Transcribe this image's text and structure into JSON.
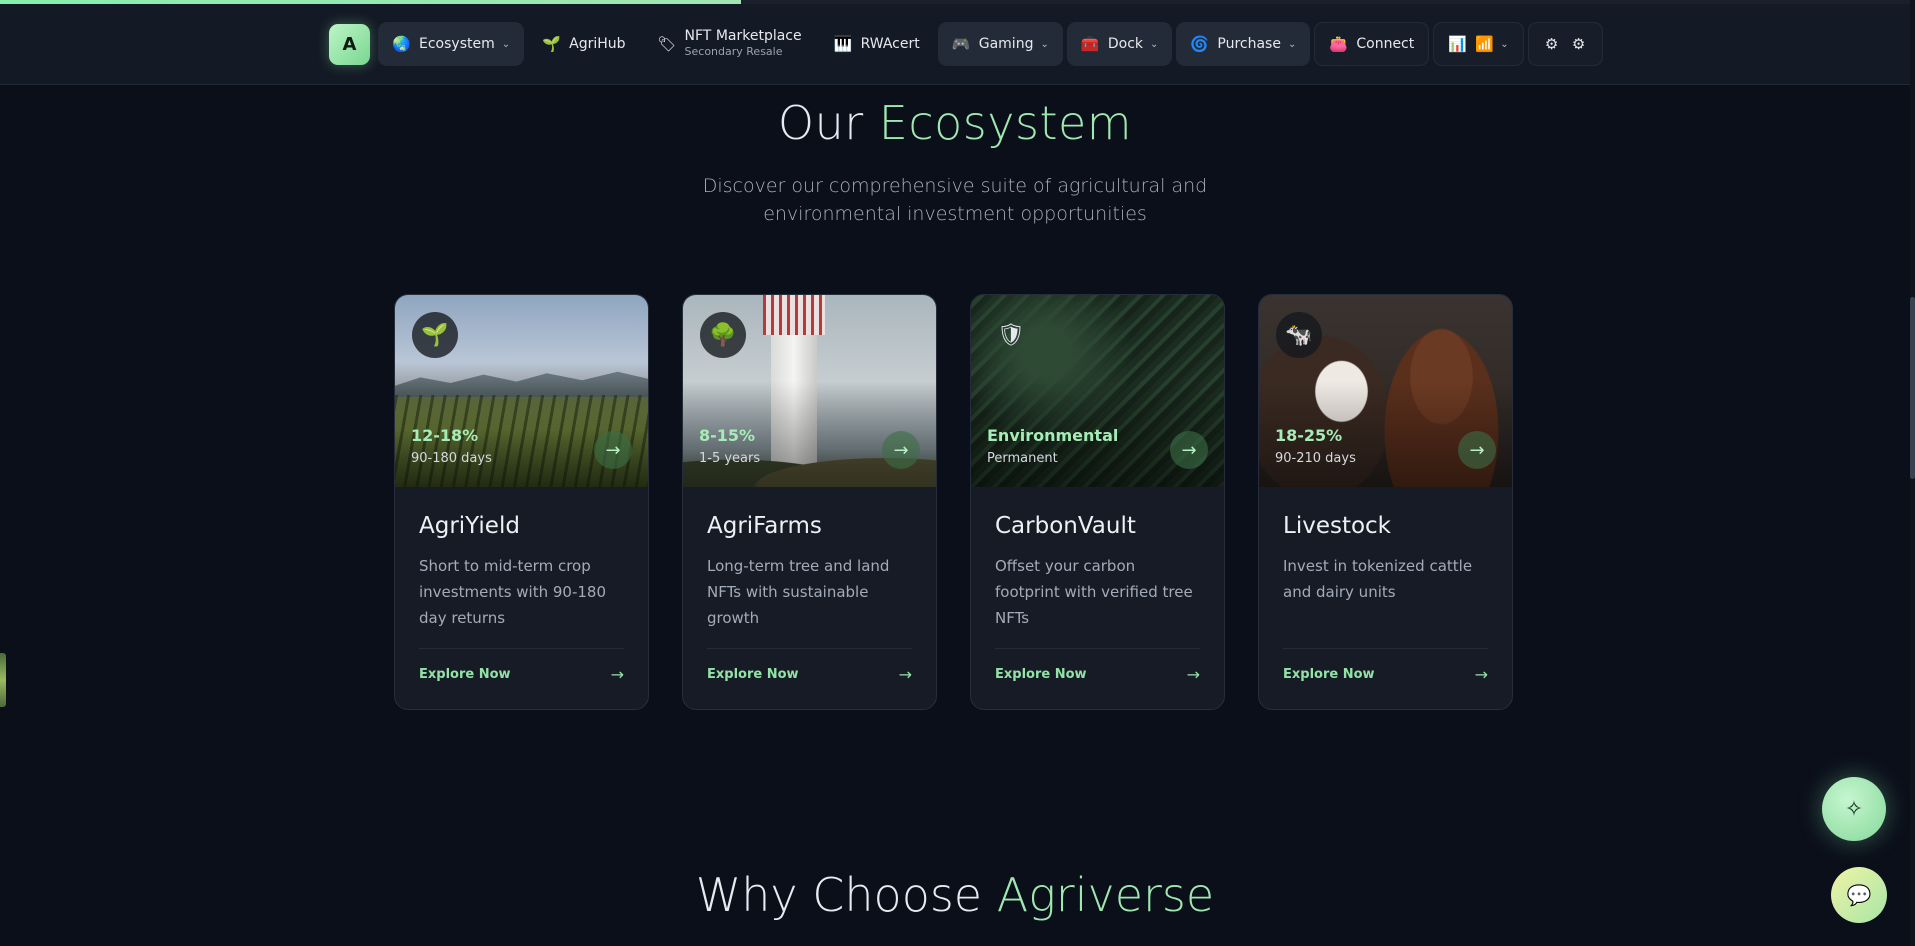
{
  "progress": {
    "fraction": 0.387
  },
  "nav": {
    "logo": "A",
    "items": [
      {
        "label": "Ecosystem",
        "icon": "🌏",
        "dropdown": true
      },
      {
        "label": "AgriHub",
        "icon": "🌱",
        "dropdown": false
      },
      {
        "label": "NFT Marketplace",
        "sub": "Secondary Resale",
        "icon": "🏷",
        "dropdown": false
      },
      {
        "label": "RWAcert",
        "icon": "🎹",
        "dropdown": false
      },
      {
        "label": "Gaming",
        "icon": "🎮",
        "dropdown": true
      },
      {
        "label": "Dock",
        "icon": "🧰",
        "dropdown": true
      },
      {
        "label": "Purchase",
        "icon": "🌀",
        "dropdown": true
      },
      {
        "label": "Connect",
        "icon": "👛",
        "dropdown": false
      }
    ],
    "chart_icons": [
      "📊",
      "📶"
    ],
    "settings_icons": [
      "⚙",
      "⚙"
    ]
  },
  "section": {
    "title_plain": "Our",
    "title_accent": "Ecosystem",
    "subtitle": "Discover our comprehensive suite of agricultural and environmental investment opportunities"
  },
  "cards": [
    {
      "title": "AgriYield",
      "rate": "12-18%",
      "term": "90-180 days",
      "desc": "Short to mid-term crop investments with 90-180 day returns",
      "cta": "Explore Now",
      "icon": "🌱"
    },
    {
      "title": "AgriFarms",
      "rate": "8-15%",
      "term": "1-5 years",
      "desc": "Long-term tree and land NFTs with sustainable growth",
      "cta": "Explore Now",
      "icon": "🌳"
    },
    {
      "title": "CarbonVault",
      "rate": "Environmental",
      "term": "Permanent",
      "desc": "Offset your carbon footprint with verified tree NFTs",
      "cta": "Explore Now",
      "icon": "🛡"
    },
    {
      "title": "Livestock",
      "rate": "18-25%",
      "term": "90-210 days",
      "desc": "Invest in tokenized cattle and dairy units",
      "cta": "Explore Now",
      "icon": "🐄"
    }
  ],
  "section2": {
    "title_plain": "Why Choose",
    "title_accent": "Agriverse"
  },
  "fabs": {
    "spark_icon": "✧",
    "chat_icon": "💬"
  },
  "colors": {
    "accent": "#9fe8b0",
    "background": "#0b0f1a",
    "card": "#161b26"
  }
}
